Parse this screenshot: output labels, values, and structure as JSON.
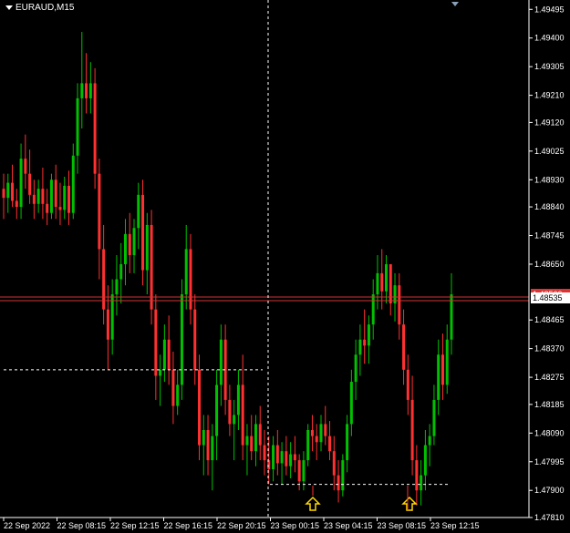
{
  "window": {
    "symbol_label": "EURAUD,M15"
  },
  "colors": {
    "background": "#000000",
    "axis": "#ffffff",
    "bull": "#00c000",
    "bear": "#ff3030",
    "price_line": "#d33333",
    "arrow": "#ffd700",
    "crosshair": "#ffffff"
  },
  "price_axis": {
    "ticks": [
      "1.49495",
      "1.49400",
      "1.49305",
      "1.49210",
      "1.49120",
      "1.49025",
      "1.48930",
      "1.48840",
      "1.48745",
      "1.48650",
      "1.48465",
      "1.48370",
      "1.48275",
      "1.48185",
      "1.48090",
      "1.47995",
      "1.47900",
      "1.47810"
    ],
    "current_price": "1.48535",
    "upper_tag_partial": "1.48560"
  },
  "time_axis": {
    "labels": [
      "22 Sep 2022",
      "22 Sep 08:15",
      "22 Sep 12:15",
      "22 Sep 16:15",
      "22 Sep 20:15",
      "23 Sep 00:15",
      "23 Sep 04:15",
      "23 Sep 08:15",
      "23 Sep 12:15"
    ]
  },
  "annotations": {
    "arrow_icons": [
      "up-arrow-icon",
      "up-arrow-icon"
    ]
  },
  "chart_data": {
    "type": "candlestick",
    "title": "EURAUD,M15",
    "ylim": [
      1.4781,
      1.4952
    ],
    "candles": [
      [
        1.489,
        1.4895,
        1.488,
        1.4887
      ],
      [
        1.4887,
        1.4895,
        1.4882,
        1.4892
      ],
      [
        1.4892,
        1.4898,
        1.4884,
        1.4886
      ],
      [
        1.4886,
        1.489,
        1.488,
        1.4884
      ],
      [
        1.4884,
        1.4905,
        1.488,
        1.49
      ],
      [
        1.49,
        1.4908,
        1.489,
        1.4895
      ],
      [
        1.4895,
        1.4903,
        1.4885,
        1.4888
      ],
      [
        1.4888,
        1.4893,
        1.488,
        1.4885
      ],
      [
        1.4885,
        1.4893,
        1.4882,
        1.489
      ],
      [
        1.489,
        1.4897,
        1.488,
        1.4885
      ],
      [
        1.4885,
        1.489,
        1.4878,
        1.4882
      ],
      [
        1.4882,
        1.4895,
        1.488,
        1.4893
      ],
      [
        1.4893,
        1.4898,
        1.488,
        1.4884
      ],
      [
        1.4884,
        1.4892,
        1.4878,
        1.4883
      ],
      [
        1.4883,
        1.4894,
        1.488,
        1.4891
      ],
      [
        1.4891,
        1.4896,
        1.4878,
        1.4882
      ],
      [
        1.4882,
        1.4905,
        1.488,
        1.4901
      ],
      [
        1.4901,
        1.4925,
        1.4895,
        1.492
      ],
      [
        1.492,
        1.4942,
        1.491,
        1.4925
      ],
      [
        1.4925,
        1.4935,
        1.4915,
        1.492
      ],
      [
        1.492,
        1.4932,
        1.4915,
        1.4925
      ],
      [
        1.4925,
        1.493,
        1.489,
        1.4895
      ],
      [
        1.4895,
        1.49,
        1.486,
        1.487
      ],
      [
        1.487,
        1.4878,
        1.4845,
        1.485
      ],
      [
        1.485,
        1.4858,
        1.483,
        1.484
      ],
      [
        1.484,
        1.486,
        1.4835,
        1.4855
      ],
      [
        1.4855,
        1.4868,
        1.4848,
        1.486
      ],
      [
        1.486,
        1.4872,
        1.4852,
        1.4865
      ],
      [
        1.4865,
        1.488,
        1.4858,
        1.4875
      ],
      [
        1.4875,
        1.4882,
        1.4862,
        1.4868
      ],
      [
        1.4868,
        1.488,
        1.4862,
        1.4877
      ],
      [
        1.4877,
        1.4892,
        1.487,
        1.4888
      ],
      [
        1.4888,
        1.4893,
        1.4858,
        1.4863
      ],
      [
        1.4863,
        1.4882,
        1.4855,
        1.4878
      ],
      [
        1.4878,
        1.4883,
        1.4845,
        1.485
      ],
      [
        1.485,
        1.4855,
        1.482,
        1.4828
      ],
      [
        1.4828,
        1.4835,
        1.4818,
        1.483
      ],
      [
        1.483,
        1.4845,
        1.4826,
        1.484
      ],
      [
        1.484,
        1.4848,
        1.4825,
        1.483
      ],
      [
        1.483,
        1.4836,
        1.4812,
        1.4818
      ],
      [
        1.4818,
        1.483,
        1.4815,
        1.4825
      ],
      [
        1.4825,
        1.486,
        1.482,
        1.4855
      ],
      [
        1.4855,
        1.4878,
        1.485,
        1.487
      ],
      [
        1.487,
        1.4875,
        1.4845,
        1.485
      ],
      [
        1.485,
        1.4855,
        1.4825,
        1.483
      ],
      [
        1.483,
        1.4835,
        1.48,
        1.4805
      ],
      [
        1.4805,
        1.4815,
        1.4795,
        1.481
      ],
      [
        1.481,
        1.4815,
        1.4795,
        1.48
      ],
      [
        1.48,
        1.4812,
        1.479,
        1.4808
      ],
      [
        1.4808,
        1.483,
        1.48,
        1.4825
      ],
      [
        1.4825,
        1.4845,
        1.4818,
        1.484
      ],
      [
        1.484,
        1.4845,
        1.4815,
        1.482
      ],
      [
        1.482,
        1.4825,
        1.4808,
        1.4812
      ],
      [
        1.4812,
        1.482,
        1.48,
        1.4815
      ],
      [
        1.4815,
        1.483,
        1.481,
        1.4825
      ],
      [
        1.4825,
        1.4835,
        1.48,
        1.4805
      ],
      [
        1.4805,
        1.4812,
        1.4795,
        1.4808
      ],
      [
        1.4808,
        1.4815,
        1.48,
        1.4803
      ],
      [
        1.4803,
        1.4815,
        1.4798,
        1.4812
      ],
      [
        1.4812,
        1.4818,
        1.48,
        1.4805
      ],
      [
        1.4805,
        1.481,
        1.4795,
        1.48
      ],
      [
        1.48,
        1.4808,
        1.4792,
        1.4797
      ],
      [
        1.4797,
        1.4808,
        1.4793,
        1.4805
      ],
      [
        1.4805,
        1.481,
        1.4795,
        1.4799
      ],
      [
        1.4799,
        1.4806,
        1.4792,
        1.4803
      ],
      [
        1.4803,
        1.4808,
        1.4795,
        1.4798
      ],
      [
        1.4798,
        1.4806,
        1.4794,
        1.4802
      ],
      [
        1.4802,
        1.4808,
        1.4796,
        1.48
      ],
      [
        1.48,
        1.4802,
        1.479,
        1.4793
      ],
      [
        1.4793,
        1.4803,
        1.479,
        1.48
      ],
      [
        1.48,
        1.4812,
        1.4798,
        1.481
      ],
      [
        1.481,
        1.4815,
        1.4803,
        1.4808
      ],
      [
        1.4808,
        1.4812,
        1.48,
        1.4806
      ],
      [
        1.4806,
        1.4815,
        1.4803,
        1.4812
      ],
      [
        1.4812,
        1.4818,
        1.4805,
        1.4808
      ],
      [
        1.4808,
        1.4813,
        1.48,
        1.4803
      ],
      [
        1.4803,
        1.4808,
        1.479,
        1.4795
      ],
      [
        1.4795,
        1.48,
        1.4786,
        1.479
      ],
      [
        1.479,
        1.4802,
        1.4788,
        1.48
      ],
      [
        1.48,
        1.4815,
        1.4796,
        1.4812
      ],
      [
        1.4812,
        1.483,
        1.4808,
        1.4826
      ],
      [
        1.4826,
        1.484,
        1.482,
        1.4835
      ],
      [
        1.4835,
        1.4845,
        1.4828,
        1.484
      ],
      [
        1.484,
        1.485,
        1.4832,
        1.4838
      ],
      [
        1.4838,
        1.4848,
        1.4832,
        1.4845
      ],
      [
        1.4845,
        1.486,
        1.484,
        1.4855
      ],
      [
        1.4855,
        1.4868,
        1.485,
        1.4862
      ],
      [
        1.4862,
        1.487,
        1.485,
        1.4856
      ],
      [
        1.4856,
        1.4868,
        1.4852,
        1.4865
      ],
      [
        1.4865,
        1.4858,
        1.4848,
        1.4852
      ],
      [
        1.4852,
        1.4862,
        1.4846,
        1.4858
      ],
      [
        1.4858,
        1.4862,
        1.484,
        1.4845
      ],
      [
        1.4845,
        1.485,
        1.4825,
        1.483
      ],
      [
        1.483,
        1.4835,
        1.4815,
        1.482
      ],
      [
        1.482,
        1.4828,
        1.4795,
        1.48
      ],
      [
        1.48,
        1.4805,
        1.4785,
        1.479
      ],
      [
        1.479,
        1.48,
        1.4785,
        1.4795
      ],
      [
        1.4795,
        1.481,
        1.479,
        1.4805
      ],
      [
        1.4805,
        1.4812,
        1.4798,
        1.4808
      ],
      [
        1.4808,
        1.4825,
        1.4805,
        1.482
      ],
      [
        1.482,
        1.484,
        1.4815,
        1.4835
      ],
      [
        1.4835,
        1.4842,
        1.482,
        1.4825
      ],
      [
        1.4825,
        1.4845,
        1.4822,
        1.484
      ],
      [
        1.484,
        1.4862,
        1.4835,
        1.4855
      ]
    ]
  }
}
